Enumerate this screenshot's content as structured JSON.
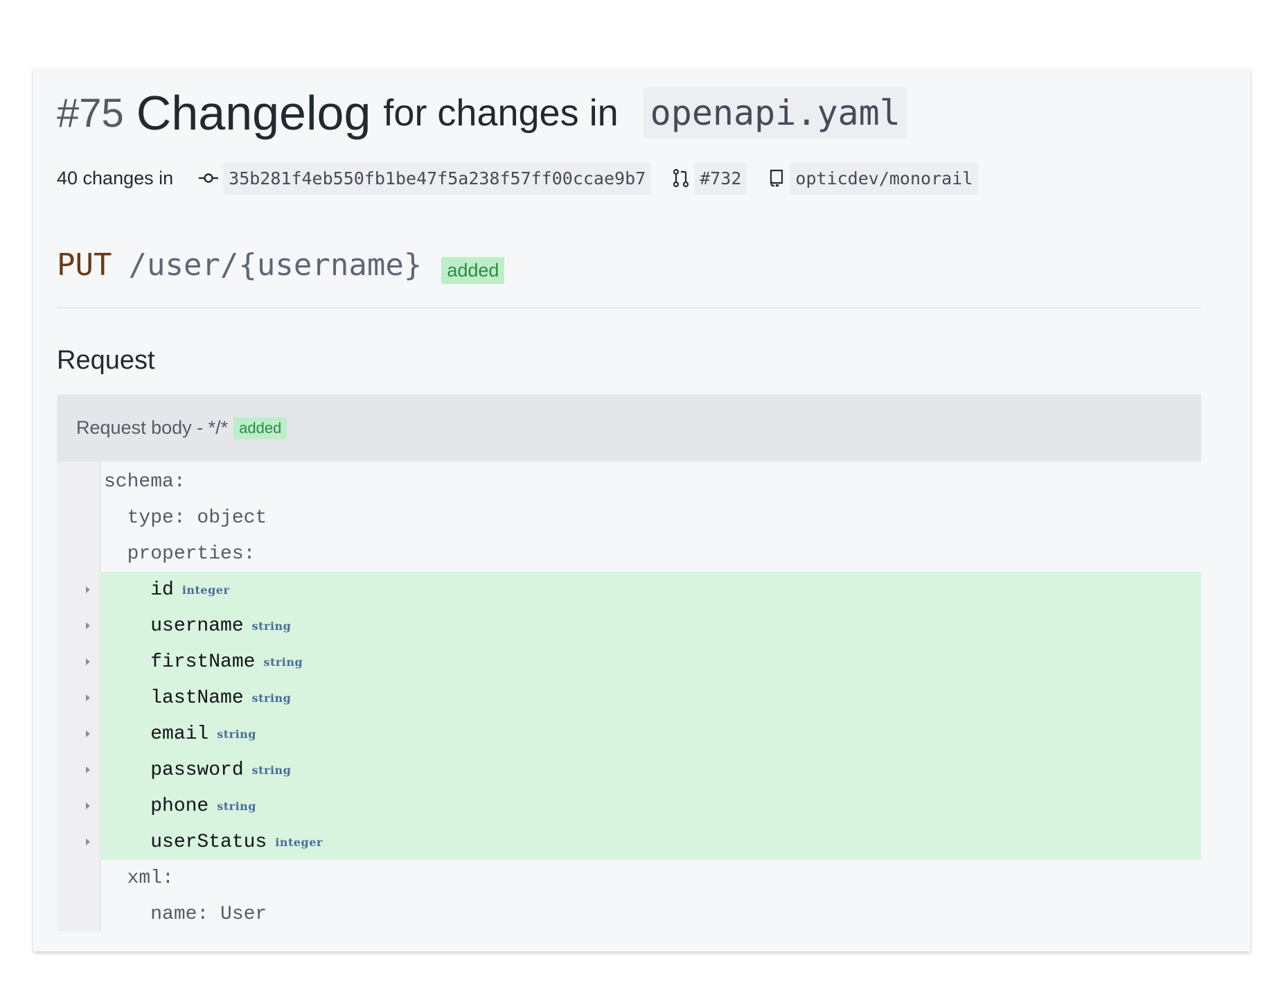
{
  "header": {
    "number": "#75",
    "title": "Changelog",
    "title_rest": "for changes in",
    "file": "openapi.yaml"
  },
  "meta": {
    "count_text": "40 changes in",
    "commit": "35b281f4eb550fb1be47f5a238f57ff00ccae9b7",
    "pr": "#732",
    "repo": "opticdev/monorail",
    "icons": [
      "commit-icon",
      "pull-request-icon",
      "repo-icon"
    ]
  },
  "endpoint": {
    "method": "PUT",
    "path": "/user/{username}",
    "badge": "added"
  },
  "request": {
    "section_title": "Request",
    "body_label": "Request body - */*",
    "body_badge": "added"
  },
  "schema_lines": [
    {
      "text": "schema:",
      "added": false
    },
    {
      "text": "  type: object",
      "added": false
    },
    {
      "text": "  properties:",
      "added": false
    },
    {
      "text": "    id",
      "type": "integer",
      "added": true
    },
    {
      "text": "    username",
      "type": "string",
      "added": true
    },
    {
      "text": "    firstName",
      "type": "string",
      "added": true
    },
    {
      "text": "    lastName",
      "type": "string",
      "added": true
    },
    {
      "text": "    email",
      "type": "string",
      "added": true
    },
    {
      "text": "    password",
      "type": "string",
      "added": true
    },
    {
      "text": "    phone",
      "type": "string",
      "added": true
    },
    {
      "text": "    userStatus",
      "type": "integer",
      "added": true
    },
    {
      "text": "  xml:",
      "added": false
    },
    {
      "text": "    name: User",
      "added": false
    }
  ],
  "colors": {
    "method": "#6b3a16",
    "added_bg": "#d8f3de",
    "badge_bg": "#bdeec8",
    "badge_text": "#2e8a45"
  }
}
